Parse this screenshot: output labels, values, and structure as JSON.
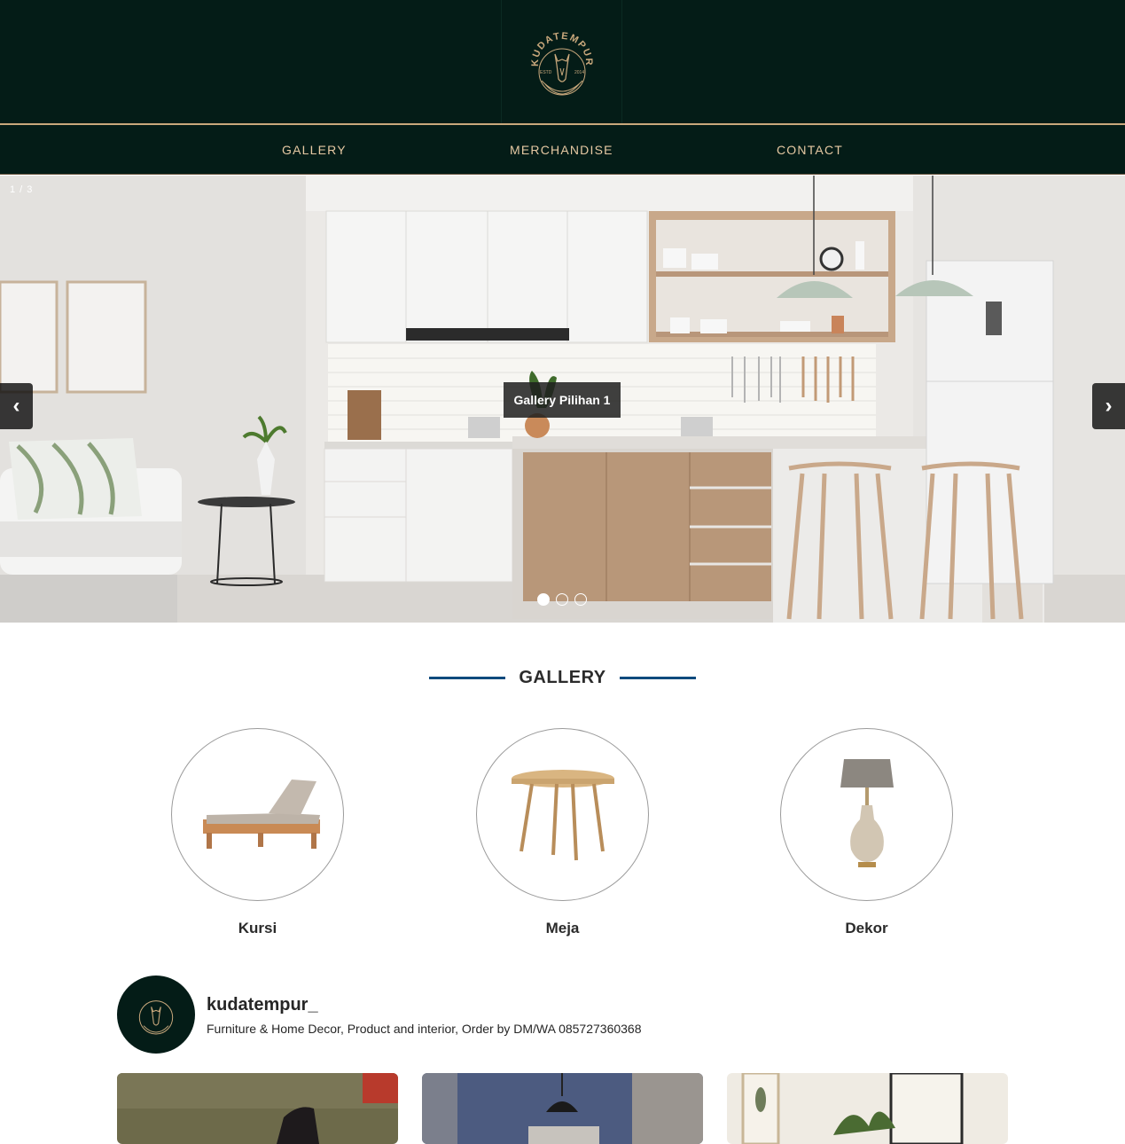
{
  "brand": {
    "name": "KUDATEMPUR",
    "estd_left": "ESTD",
    "estd_right": "2014"
  },
  "nav": {
    "items": [
      {
        "label": "GALLERY"
      },
      {
        "label": "MERCHANDISE"
      },
      {
        "label": "CONTACT"
      }
    ]
  },
  "slider": {
    "counter": "1 / 3",
    "caption": "Gallery Pilihan 1",
    "prev_label": "‹",
    "next_label": "›",
    "slide_count": 3,
    "active_index": 0
  },
  "gallery": {
    "title": "GALLERY",
    "categories": [
      {
        "label": "Kursi",
        "icon": "lounge-chair-image"
      },
      {
        "label": "Meja",
        "icon": "round-table-image"
      },
      {
        "label": "Dekor",
        "icon": "table-lamp-image"
      }
    ]
  },
  "instagram": {
    "username": "kudatempur_",
    "bio": "Furniture & Home Decor, Product and interior, Order by DM/WA 085727360368"
  },
  "colors": {
    "header_bg": "#041c17",
    "gold": "#c9a87c",
    "nav_text": "#e6c9a3",
    "title_line": "#0f4a7d"
  }
}
